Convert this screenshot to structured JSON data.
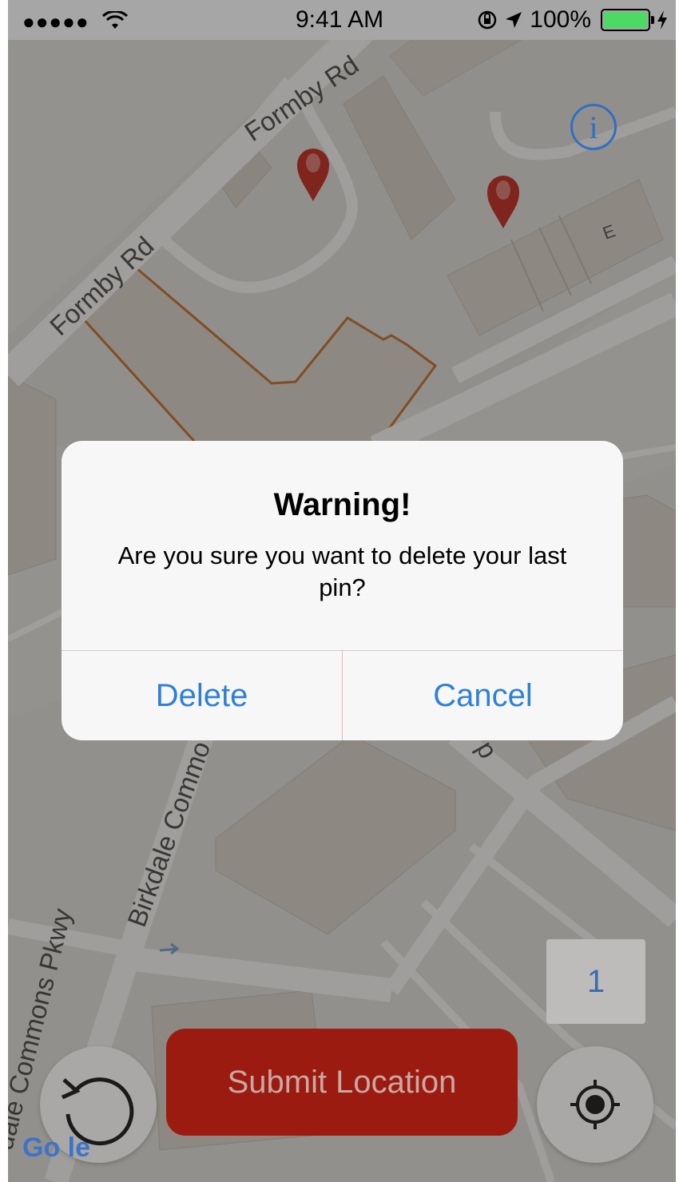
{
  "status_bar": {
    "signal": "●●●●●",
    "time": "9:41 AM",
    "battery_text": "100%"
  },
  "map": {
    "road_labels": [
      "Formby Rd",
      "Formby Rd",
      "Birkdale Commo",
      "dale Commons Pkwy",
      "d"
    ],
    "building_label": "E",
    "pins": 2,
    "brand": "Go     le"
  },
  "alert": {
    "title": "Warning!",
    "message": "Are you sure you want to delete your last pin?",
    "buttons": [
      "Delete",
      "Cancel"
    ],
    "button_color": "#2f80d9"
  },
  "controls": {
    "pin_count": "1",
    "submit_label": "Submit Location",
    "submit_color": "#9c1b10",
    "undo_icon": "undo-icon",
    "locate_icon": "locate-icon",
    "info_icon": "info-icon"
  }
}
